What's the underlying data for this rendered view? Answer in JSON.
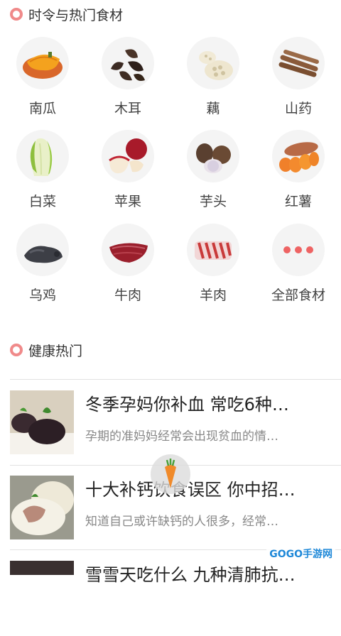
{
  "section1": {
    "title": "时令与热门食材"
  },
  "foods": [
    {
      "label": "南瓜",
      "icon": "pumpkin-icon"
    },
    {
      "label": "木耳",
      "icon": "wood-ear-icon"
    },
    {
      "label": "藕",
      "icon": "lotus-root-icon"
    },
    {
      "label": "山药",
      "icon": "yam-icon"
    },
    {
      "label": "白菜",
      "icon": "cabbage-icon"
    },
    {
      "label": "苹果",
      "icon": "apple-icon"
    },
    {
      "label": "芋头",
      "icon": "taro-icon"
    },
    {
      "label": "红薯",
      "icon": "sweet-potato-icon"
    },
    {
      "label": "乌鸡",
      "icon": "black-chicken-icon"
    },
    {
      "label": "牛肉",
      "icon": "beef-icon"
    },
    {
      "label": "羊肉",
      "icon": "mutton-icon"
    },
    {
      "label": "全部食材",
      "icon": "more-icon"
    }
  ],
  "section2": {
    "title": "健康热门"
  },
  "articles": [
    {
      "title": "冬季孕妈你补血 常吃6种…",
      "desc": "孕期的准妈妈经常会出现贫血的情…"
    },
    {
      "title": "十大补钙饮食误区 你中招…",
      "desc": "知道自己或许缺钙的人很多，经常…"
    },
    {
      "title": "雪雪天吃什么 九种清肺抗…",
      "desc": ""
    }
  ],
  "watermark": {
    "text": "GOGO手游网"
  }
}
